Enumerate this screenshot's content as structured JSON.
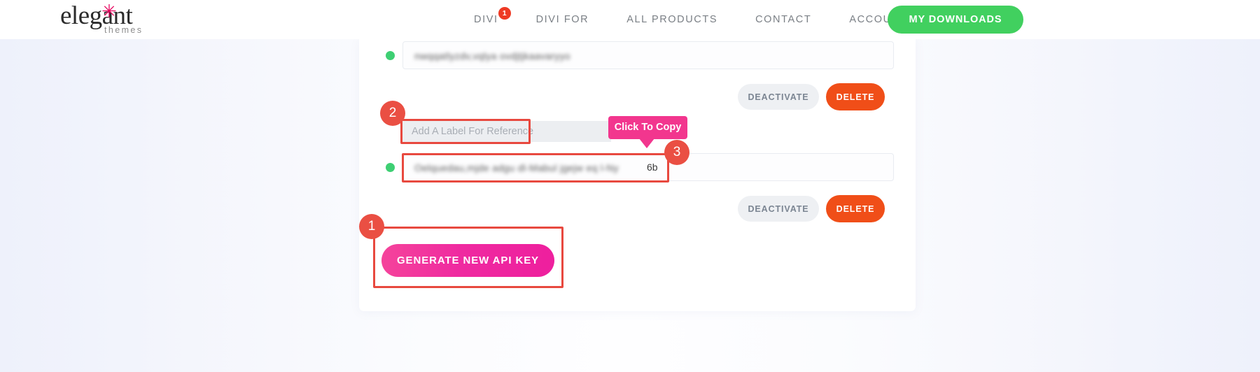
{
  "header": {
    "logo": {
      "word": "elegant",
      "star": "✳",
      "sub": "themes"
    },
    "nav": [
      {
        "label": "DIVI",
        "badge": "1"
      },
      {
        "label": "DIVI FOR",
        "badge": null
      },
      {
        "label": "ALL PRODUCTS",
        "badge": null
      },
      {
        "label": "CONTACT",
        "badge": null
      },
      {
        "label": "ACCOUNT",
        "badge": null
      }
    ],
    "downloads_button": "MY DOWNLOADS"
  },
  "api_keys": {
    "rows": [
      {
        "status": "active",
        "key_masked": "nwqqatlyzdv,vqlya ovdjtjkaavaryyo",
        "key_tail": "",
        "deactivate_label": "DEACTIVATE",
        "delete_label": "DELETE"
      },
      {
        "status": "active",
        "key_masked": "Oelquedau,mjde adgu dl-Mabul jgejw eq l-Ny",
        "key_tail": "6b",
        "deactivate_label": "DEACTIVATE",
        "delete_label": "DELETE"
      }
    ],
    "label_input_placeholder": "Add A Label For Reference",
    "label_input_value": "",
    "generate_button": "GENERATE NEW API KEY"
  },
  "tooltip": {
    "text": "Click To Copy"
  },
  "annotations": [
    {
      "number": "1",
      "target": "generate-new-api-key-button"
    },
    {
      "number": "2",
      "target": "label-input"
    },
    {
      "number": "3",
      "target": "api-key-field-2"
    }
  ],
  "colors": {
    "brand_pink": "#ee1f9e",
    "accent_green": "#41d05f",
    "delete_orange": "#f04e18",
    "status_green": "#3ecf73",
    "annotation_red": "#e8493f",
    "tooltip_pink": "#f2368e",
    "badge_red": "#ee3a24"
  }
}
